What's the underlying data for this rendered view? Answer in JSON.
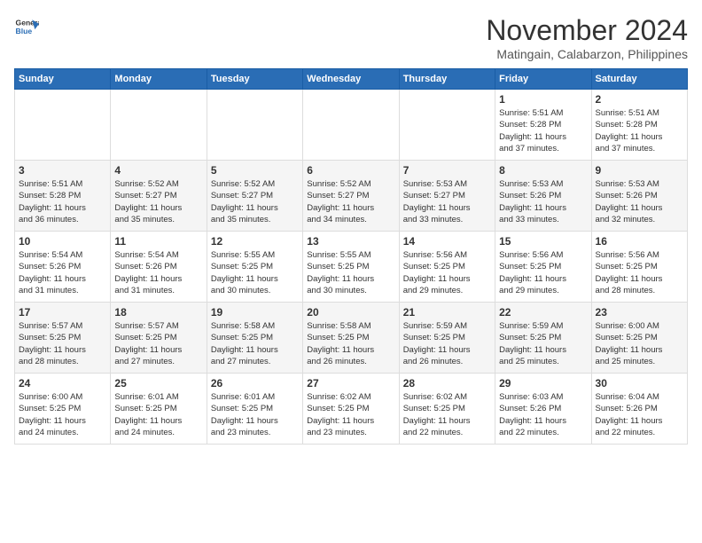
{
  "header": {
    "logo_line1": "General",
    "logo_line2": "Blue",
    "month": "November 2024",
    "location": "Matingain, Calabarzon, Philippines"
  },
  "weekdays": [
    "Sunday",
    "Monday",
    "Tuesday",
    "Wednesday",
    "Thursday",
    "Friday",
    "Saturday"
  ],
  "weeks": [
    [
      {
        "day": "",
        "info": ""
      },
      {
        "day": "",
        "info": ""
      },
      {
        "day": "",
        "info": ""
      },
      {
        "day": "",
        "info": ""
      },
      {
        "day": "",
        "info": ""
      },
      {
        "day": "1",
        "info": "Sunrise: 5:51 AM\nSunset: 5:28 PM\nDaylight: 11 hours\nand 37 minutes."
      },
      {
        "day": "2",
        "info": "Sunrise: 5:51 AM\nSunset: 5:28 PM\nDaylight: 11 hours\nand 37 minutes."
      }
    ],
    [
      {
        "day": "3",
        "info": "Sunrise: 5:51 AM\nSunset: 5:28 PM\nDaylight: 11 hours\nand 36 minutes."
      },
      {
        "day": "4",
        "info": "Sunrise: 5:52 AM\nSunset: 5:27 PM\nDaylight: 11 hours\nand 35 minutes."
      },
      {
        "day": "5",
        "info": "Sunrise: 5:52 AM\nSunset: 5:27 PM\nDaylight: 11 hours\nand 35 minutes."
      },
      {
        "day": "6",
        "info": "Sunrise: 5:52 AM\nSunset: 5:27 PM\nDaylight: 11 hours\nand 34 minutes."
      },
      {
        "day": "7",
        "info": "Sunrise: 5:53 AM\nSunset: 5:27 PM\nDaylight: 11 hours\nand 33 minutes."
      },
      {
        "day": "8",
        "info": "Sunrise: 5:53 AM\nSunset: 5:26 PM\nDaylight: 11 hours\nand 33 minutes."
      },
      {
        "day": "9",
        "info": "Sunrise: 5:53 AM\nSunset: 5:26 PM\nDaylight: 11 hours\nand 32 minutes."
      }
    ],
    [
      {
        "day": "10",
        "info": "Sunrise: 5:54 AM\nSunset: 5:26 PM\nDaylight: 11 hours\nand 31 minutes."
      },
      {
        "day": "11",
        "info": "Sunrise: 5:54 AM\nSunset: 5:26 PM\nDaylight: 11 hours\nand 31 minutes."
      },
      {
        "day": "12",
        "info": "Sunrise: 5:55 AM\nSunset: 5:25 PM\nDaylight: 11 hours\nand 30 minutes."
      },
      {
        "day": "13",
        "info": "Sunrise: 5:55 AM\nSunset: 5:25 PM\nDaylight: 11 hours\nand 30 minutes."
      },
      {
        "day": "14",
        "info": "Sunrise: 5:56 AM\nSunset: 5:25 PM\nDaylight: 11 hours\nand 29 minutes."
      },
      {
        "day": "15",
        "info": "Sunrise: 5:56 AM\nSunset: 5:25 PM\nDaylight: 11 hours\nand 29 minutes."
      },
      {
        "day": "16",
        "info": "Sunrise: 5:56 AM\nSunset: 5:25 PM\nDaylight: 11 hours\nand 28 minutes."
      }
    ],
    [
      {
        "day": "17",
        "info": "Sunrise: 5:57 AM\nSunset: 5:25 PM\nDaylight: 11 hours\nand 28 minutes."
      },
      {
        "day": "18",
        "info": "Sunrise: 5:57 AM\nSunset: 5:25 PM\nDaylight: 11 hours\nand 27 minutes."
      },
      {
        "day": "19",
        "info": "Sunrise: 5:58 AM\nSunset: 5:25 PM\nDaylight: 11 hours\nand 27 minutes."
      },
      {
        "day": "20",
        "info": "Sunrise: 5:58 AM\nSunset: 5:25 PM\nDaylight: 11 hours\nand 26 minutes."
      },
      {
        "day": "21",
        "info": "Sunrise: 5:59 AM\nSunset: 5:25 PM\nDaylight: 11 hours\nand 26 minutes."
      },
      {
        "day": "22",
        "info": "Sunrise: 5:59 AM\nSunset: 5:25 PM\nDaylight: 11 hours\nand 25 minutes."
      },
      {
        "day": "23",
        "info": "Sunrise: 6:00 AM\nSunset: 5:25 PM\nDaylight: 11 hours\nand 25 minutes."
      }
    ],
    [
      {
        "day": "24",
        "info": "Sunrise: 6:00 AM\nSunset: 5:25 PM\nDaylight: 11 hours\nand 24 minutes."
      },
      {
        "day": "25",
        "info": "Sunrise: 6:01 AM\nSunset: 5:25 PM\nDaylight: 11 hours\nand 24 minutes."
      },
      {
        "day": "26",
        "info": "Sunrise: 6:01 AM\nSunset: 5:25 PM\nDaylight: 11 hours\nand 23 minutes."
      },
      {
        "day": "27",
        "info": "Sunrise: 6:02 AM\nSunset: 5:25 PM\nDaylight: 11 hours\nand 23 minutes."
      },
      {
        "day": "28",
        "info": "Sunrise: 6:02 AM\nSunset: 5:25 PM\nDaylight: 11 hours\nand 22 minutes."
      },
      {
        "day": "29",
        "info": "Sunrise: 6:03 AM\nSunset: 5:26 PM\nDaylight: 11 hours\nand 22 minutes."
      },
      {
        "day": "30",
        "info": "Sunrise: 6:04 AM\nSunset: 5:26 PM\nDaylight: 11 hours\nand 22 minutes."
      }
    ]
  ]
}
